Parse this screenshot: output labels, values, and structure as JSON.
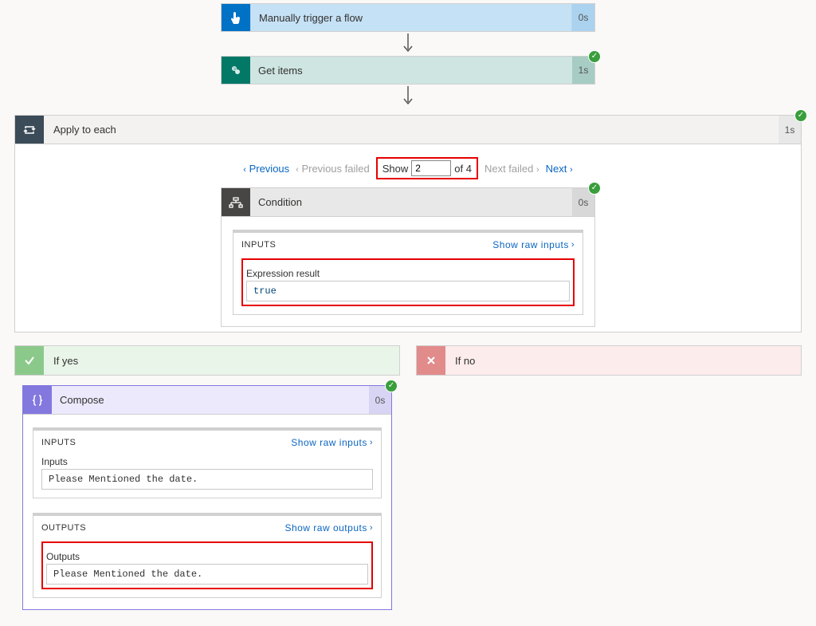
{
  "trigger": {
    "title": "Manually trigger a flow",
    "duration": "0s"
  },
  "getitems": {
    "title": "Get items",
    "duration": "1s"
  },
  "apply": {
    "title": "Apply to each",
    "duration": "1s"
  },
  "pager": {
    "prev": "Previous",
    "prev_failed": "Previous failed",
    "show": "Show",
    "value": "2",
    "of": "of 4",
    "next_failed": "Next failed",
    "next": "Next"
  },
  "condition": {
    "title": "Condition",
    "duration": "0s",
    "inputs_label": "INPUTS",
    "raw_inputs": "Show raw inputs",
    "field_label": "Expression result",
    "field_value": "true"
  },
  "branches": {
    "yes": "If yes",
    "no": "If no"
  },
  "compose": {
    "title": "Compose",
    "duration": "0s",
    "inputs_label": "INPUTS",
    "raw_inputs": "Show raw inputs",
    "inputs_field_label": "Inputs",
    "inputs_value": "Please Mentioned the date.",
    "outputs_label": "OUTPUTS",
    "raw_outputs": "Show raw outputs",
    "outputs_field_label": "Outputs",
    "outputs_value": "Please Mentioned the date."
  }
}
